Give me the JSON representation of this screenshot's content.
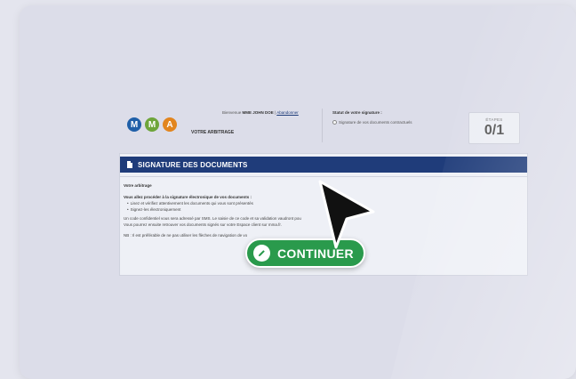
{
  "header": {
    "logos": [
      "M",
      "M",
      "A"
    ],
    "welcome_prefix": "Bienvenue",
    "user_name": "MME JOHN DOE",
    "abandon_link": "Abandonner",
    "section_name": "VOTRE ARBITRAGE"
  },
  "status": {
    "title": "Statut de votre signature :",
    "item": "Signature de vos documents contractuels"
  },
  "steps": {
    "label": "ÉTAPES",
    "value": "0/1"
  },
  "main": {
    "band_title": "SIGNATURE DES DOCUMENTS",
    "subtitle": "Votre arbitrage",
    "lead": "Vous allez procéder à la signature électronique de vos documents :",
    "bullets": [
      "Lisez et vérifiez attentivement les documents qui vous sont présentés",
      "Signez-les électroniquement"
    ],
    "line1": "Un code confidentiel vous sera adressé par SMS. Le saisie de ce code et sa validation vaudront pou",
    "line2": "Vous pourrez ensuite retrouver vos documents signés sur votre Espace client sur mma.fr.",
    "note": "NB : Il est préférable de ne pas utiliser les flèches de navigation de vo"
  },
  "cta": {
    "label": "CONTINUER",
    "color": "#2a9a4c",
    "icon": "pencil-icon"
  },
  "colors": {
    "band": "#1f3c7a",
    "logo_blue": "#1f5fa8",
    "logo_green": "#6ea53a",
    "logo_orange": "#e2851e"
  }
}
